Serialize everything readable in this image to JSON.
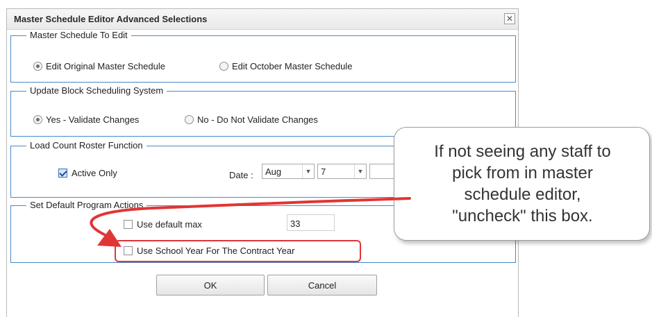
{
  "dialog": {
    "title": "Master Schedule Editor Advanced Selections",
    "close_symbol": "✕"
  },
  "master_schedule": {
    "legend": "Master Schedule To Edit",
    "options": [
      {
        "label": "Edit Original Master Schedule",
        "checked": true
      },
      {
        "label": "Edit October Master Schedule",
        "checked": false
      }
    ]
  },
  "block_scheduling": {
    "legend": "Update Block Scheduling System",
    "options": [
      {
        "label": "Yes - Validate Changes",
        "checked": true
      },
      {
        "label": "No - Do Not Validate Changes",
        "checked": false
      }
    ]
  },
  "load_count": {
    "legend": "Load Count Roster Function",
    "active_only_label": "Active Only",
    "active_only_checked": true,
    "date_label": "Date :",
    "month_value": "Aug",
    "day_value": "7"
  },
  "default_program": {
    "legend": "Set Default Program Actions",
    "use_default_max_label": "Use default max",
    "use_default_max_checked": false,
    "default_max_value": "33",
    "use_school_year_label": "Use School Year For The Contract Year",
    "use_school_year_checked": false
  },
  "buttons": {
    "ok_label": "OK",
    "cancel_label": "Cancel"
  },
  "callout": {
    "lines": [
      "If not seeing any staff to",
      "pick from in master",
      "schedule editor,",
      "\"uncheck\" this box."
    ]
  },
  "colors": {
    "group_border": "#4a88c7",
    "annotation_red": "#e03535"
  }
}
